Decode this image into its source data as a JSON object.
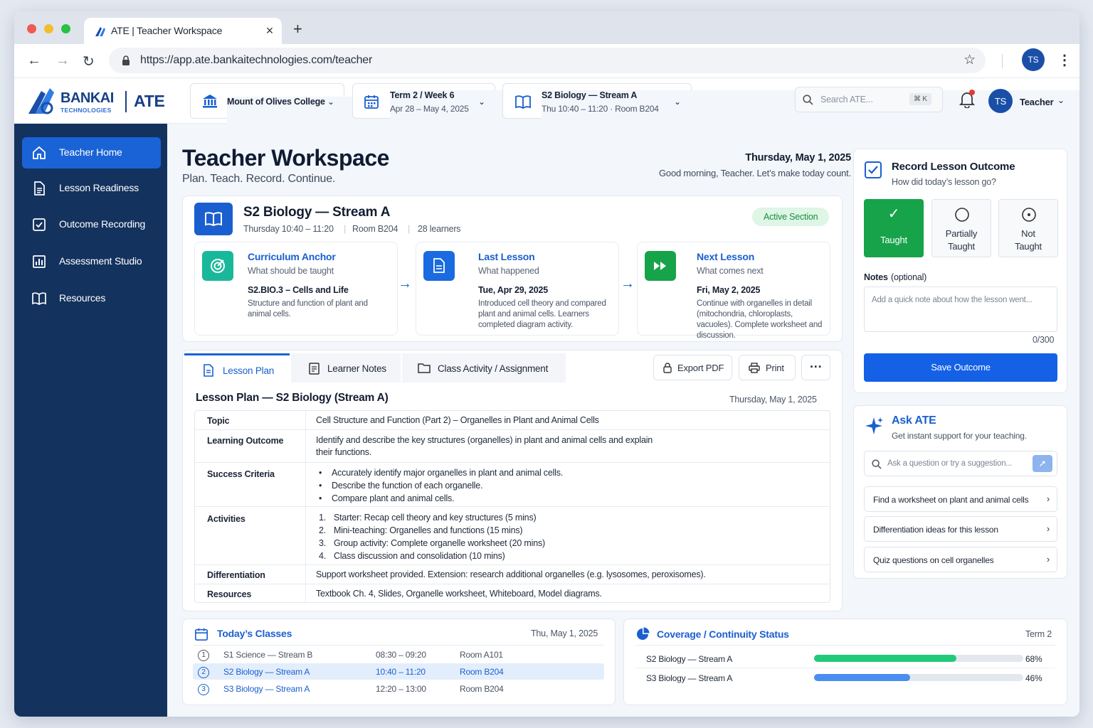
{
  "browser": {
    "tab_title": "ATE | Teacher Workspace",
    "url": "https://app.ate.bankaitechnologies.com/teacher",
    "profile_initials": "TS"
  },
  "header": {
    "brand": "BANKAI",
    "brand_sub": "TECHNOLOGIES",
    "product": "ATE",
    "school": "Mount of Olives College",
    "term": {
      "main": "Term 2 / Week 6",
      "sub": "Apr 28 – May 4, 2025"
    },
    "klass": {
      "main": "S2 Biology — Stream A",
      "sub": "Thu 10:40 – 11:20 · Room B204"
    },
    "search_placeholder": "Search ATE...",
    "shortcut": "⌘ K",
    "user_initials": "TS",
    "user_name": "Teacher"
  },
  "sidebar": {
    "items": [
      {
        "label": "Teacher Home"
      },
      {
        "label": "Lesson Readiness"
      },
      {
        "label": "Outcome Recording"
      },
      {
        "label": "Assessment Studio"
      },
      {
        "label": "Resources"
      }
    ]
  },
  "page": {
    "title": "Teacher Workspace",
    "tagline": "Plan. Teach. Record. Continue.",
    "date": "Thursday, May 1, 2025",
    "greeting": "Good morning, Teacher. Let’s make today count."
  },
  "section": {
    "title": "S2 Biology — Stream A",
    "time": "Thursday 10:40 – 11:20",
    "room": "Room B204",
    "learners": "28 learners",
    "badge": "Active Section",
    "cards": [
      {
        "title": "Curriculum Anchor",
        "subtitle": "What should be taught",
        "head": "S2.BIO.3 – Cells and Life",
        "body": "Structure and function of plant and animal cells."
      },
      {
        "title": "Last Lesson",
        "subtitle": "What happened",
        "head": "Tue, Apr 29, 2025",
        "body": "Introduced cell theory and compared plant and animal cells. Learners completed diagram activity."
      },
      {
        "title": "Next Lesson",
        "subtitle": "What comes next",
        "head": "Fri, May 2, 2025",
        "body": "Continue with organelles in detail (mitochondria, chloroplasts, vacuoles). Complete worksheet and discussion."
      }
    ]
  },
  "plan": {
    "tabs": [
      "Lesson Plan",
      "Learner Notes",
      "Class Activity / Assignment"
    ],
    "export": "Export PDF",
    "print": "Print",
    "title": "Lesson Plan — S2 Biology (Stream A)",
    "date": "Thursday, May 1, 2025",
    "rows": {
      "topic_k": "Topic",
      "topic_v": "Cell Structure and Function (Part 2) – Organelles in Plant and Animal Cells",
      "lo_k": "Learning Outcome",
      "lo_v1": "Identify and describe the key structures (organelles) in plant and animal cells and explain",
      "lo_v2": "their functions.",
      "sc_k": "Success Criteria",
      "sc": [
        "Accurately identify major organelles in plant and animal cells.",
        "Describe the function of each organelle.",
        "Compare plant and animal cells."
      ],
      "act_k": "Activities",
      "act": [
        "Starter: Recap cell theory and key structures (5 mins)",
        "Mini-teaching: Organelles and functions (15 mins)",
        "Group activity: Complete organelle worksheet (20 mins)",
        "Class discussion and consolidation (10 mins)"
      ],
      "diff_k": "Differentiation",
      "diff_v": "Support worksheet provided. Extension: research additional organelles (e.g. lysosomes, peroxisomes).",
      "res_k": "Resources",
      "res_v": "Textbook Ch. 4, Slides, Organelle worksheet, Whiteboard, Model diagrams."
    }
  },
  "outcome": {
    "title": "Record Lesson Outcome",
    "subtitle": "How did today’s lesson go?",
    "options": [
      "Taught",
      "Partially",
      "Taught",
      "Not",
      "Taught"
    ],
    "notes_label": "Notes",
    "notes_opt": "(optional)",
    "notes_placeholder": "Add a quick note about how the lesson went...",
    "counter": "0/300",
    "save": "Save Outcome"
  },
  "ask": {
    "title": "Ask ATE",
    "subtitle": "Get instant support for your teaching.",
    "placeholder": "Ask a question or try a suggestion...",
    "suggestions": [
      "Find a worksheet on plant and animal cells",
      "Differentiation ideas for this lesson",
      "Quiz questions on cell organelles"
    ]
  },
  "today": {
    "title": "Today’s Classes",
    "date": "Thu, May 1, 2025",
    "rows": [
      {
        "n": "1",
        "name": "S1 Science — Stream B",
        "time": "08:30 – 09:20",
        "room": "Room A101"
      },
      {
        "n": "2",
        "name": "S2 Biology — Stream A",
        "time": "10:40 – 11:20",
        "room": "Room B204"
      },
      {
        "n": "3",
        "name": "S3 Biology — Stream A",
        "time": "12:20 – 13:00",
        "room": "Room B204"
      }
    ]
  },
  "coverage": {
    "title": "Coverage / Continuity Status",
    "term": "Term 2",
    "rows": [
      {
        "name": "S2 Biology — Stream A",
        "pct_label": "68%",
        "pct": 68,
        "color": "#22c97a"
      },
      {
        "name": "S3 Biology — Stream A",
        "pct_label": "46%",
        "pct": 46,
        "color": "#4a8ef0"
      }
    ]
  }
}
